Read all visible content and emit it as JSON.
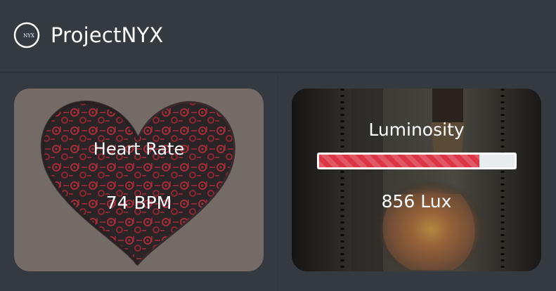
{
  "app": {
    "brand_name": "ProjectNYX",
    "logo_text": "NYX",
    "logo_icon": "crescent-moon-icon"
  },
  "cards": {
    "heart_rate": {
      "title": "Heart Rate",
      "value": "74 BPM",
      "background_icon": "mechanical-heart-icon"
    },
    "luminosity": {
      "title": "Luminosity",
      "value": "856 Lux",
      "background_icon": "light-bulb-icon",
      "progress_fraction": 0.82
    }
  },
  "colors": {
    "page_bg": "#343a40",
    "accent_red": "#dc3545",
    "heart_red": "#9c2b36"
  }
}
